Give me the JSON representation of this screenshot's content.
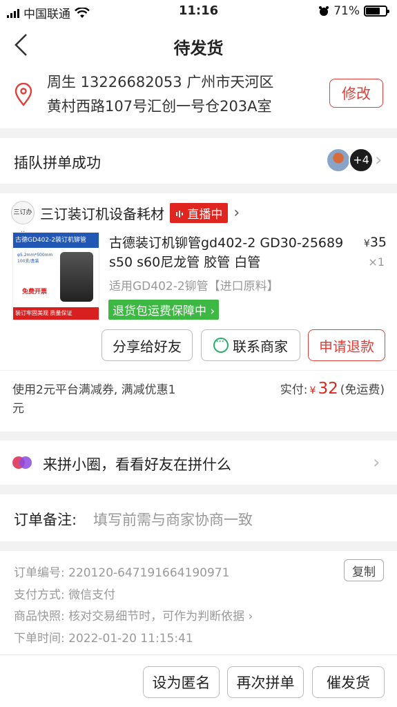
{
  "status_bar": {
    "carrier": "中国联通",
    "time": "11:16",
    "battery": "71%",
    "battery_level": 0.71
  },
  "header": {
    "title": "待发货"
  },
  "address": {
    "line1": "周生  13226682053  广州市天河区",
    "line2": "黄村西路107号汇创一号仓203A室",
    "modify_label": "修改"
  },
  "group": {
    "label": "插队拼单成功",
    "more_count": "+4"
  },
  "shop": {
    "logo_text": "三订办公",
    "name": "三订装订机设备耗材",
    "live_label": "直播中"
  },
  "product": {
    "image_title": "古德GD402-2装订机铆管",
    "image_lines": [
      "φ5.2mm*500mm",
      "100支/盒装"
    ],
    "image_badge": "免费开票",
    "image_footer": "装订牢固美观  质量保证",
    "title": "古德装订机铆管gd402-2 GD30-25689 s50 s60尼龙管 胶管 白管",
    "price_symbol": "¥",
    "price": "35",
    "qty": "×1",
    "spec": "适用GD402-2铆管【进口原料】",
    "guarantee": "退货包运费保障中"
  },
  "actions": {
    "share": "分享给好友",
    "contact": "联系商家",
    "refund": "申请退款"
  },
  "payment": {
    "coupon": "使用2元平台满减券, 满减优惠1元",
    "paid_label": "实付:",
    "currency": "¥",
    "amount": "32",
    "shipping": "(免运费)"
  },
  "circle": {
    "label": "来拼小圈，看看好友在拼什么"
  },
  "remark": {
    "label": "订单备注:",
    "placeholder": "填写前需与商家协商一致"
  },
  "order_info": {
    "order_no": "订单编号:  220120-647191664190971",
    "copy_label": "复制",
    "pay_method": "支付方式:  微信支付",
    "snapshot": "商品快照:  核对交易细节时，可作为判断依据",
    "order_time": "下单时间:  2022-01-20 11:15:41"
  },
  "bottom_bar": {
    "anonymous": "设为匿名",
    "regroup": "再次拼单",
    "urge": "催发货"
  },
  "colors": {
    "accent": "#e0251f",
    "green": "#3cb843"
  }
}
